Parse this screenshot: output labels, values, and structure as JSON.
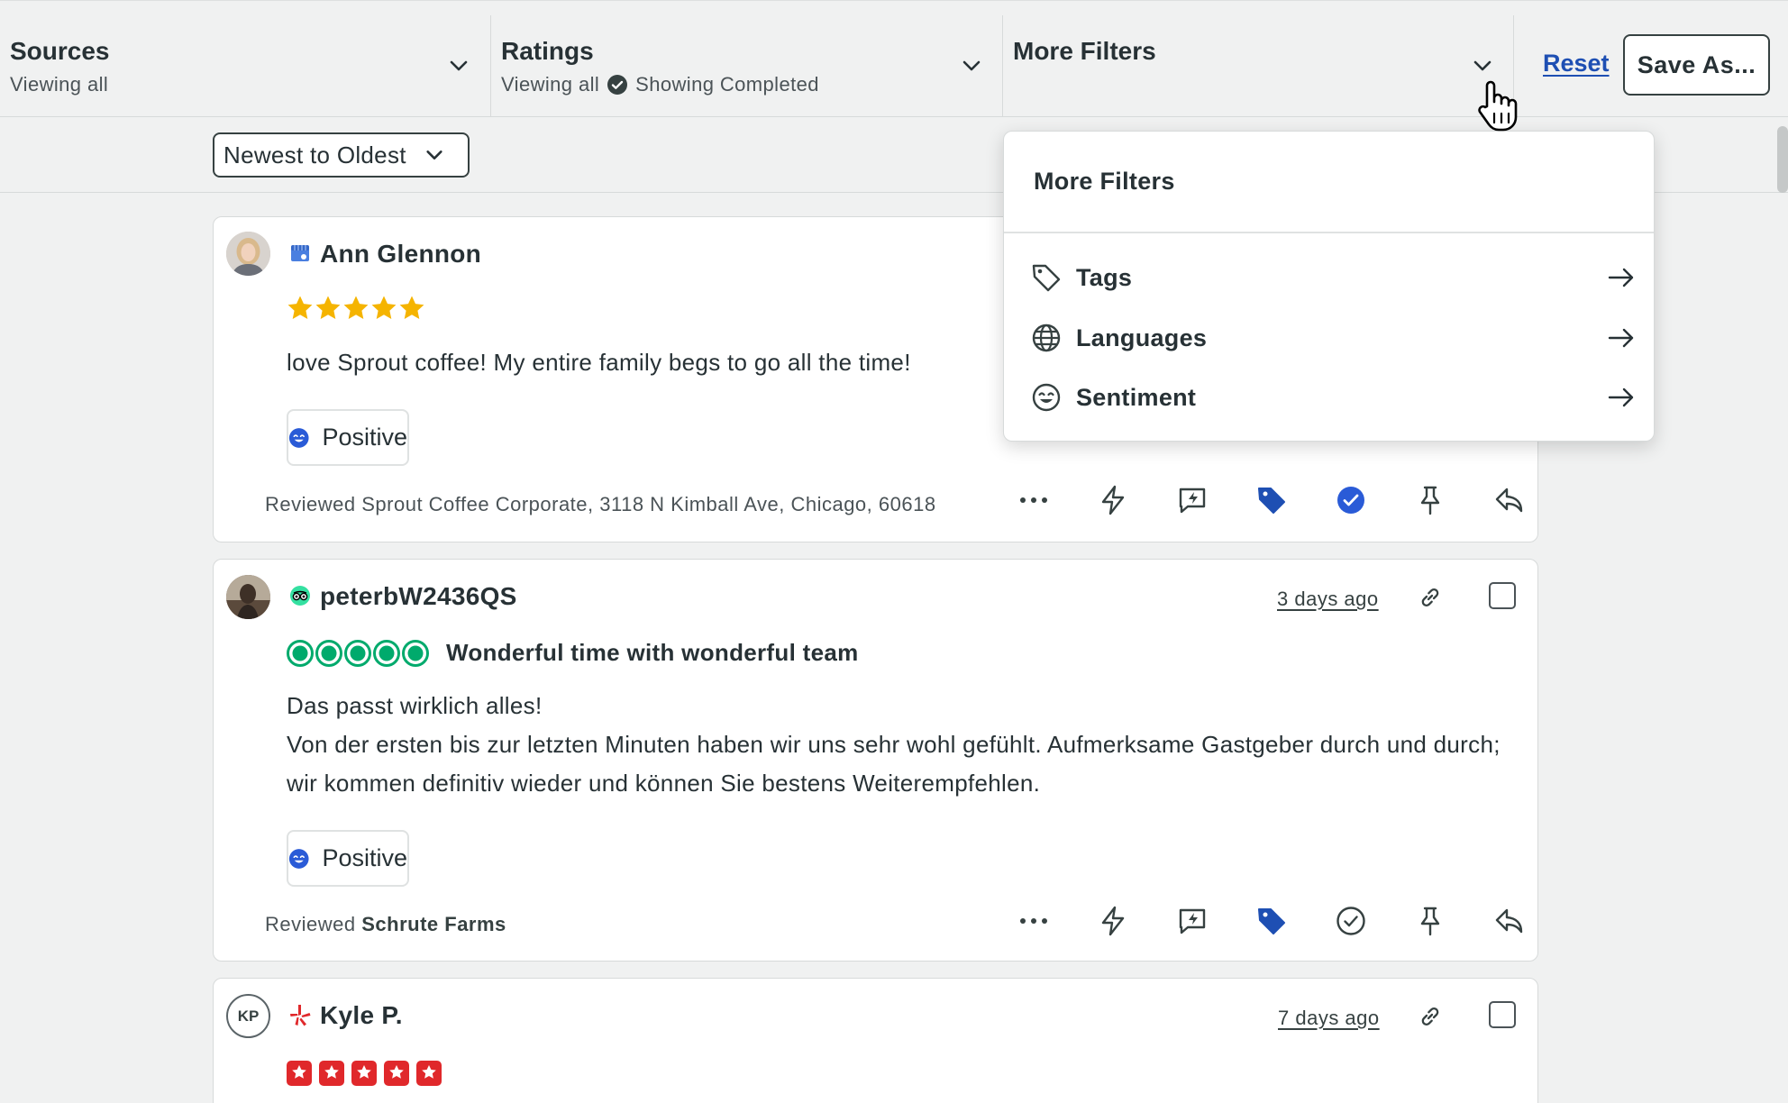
{
  "filters": {
    "sources": {
      "title": "Sources",
      "subtitle": "Viewing all"
    },
    "ratings": {
      "title": "Ratings",
      "subtitle": "Viewing all",
      "status": "Showing Completed"
    },
    "more": {
      "title": "More Filters"
    },
    "reset_label": "Reset",
    "save_label": "Save As..."
  },
  "sort": {
    "selected": "Newest to Oldest"
  },
  "dropdown": {
    "title": "More Filters",
    "items": [
      {
        "label": "Tags",
        "icon": "tag-icon"
      },
      {
        "label": "Languages",
        "icon": "globe-icon"
      },
      {
        "label": "Sentiment",
        "icon": "smile-icon"
      }
    ]
  },
  "reviews": [
    {
      "author": "Ann Glennon",
      "source": "Google",
      "rating": 5,
      "text": "love Sprout coffee! My entire family begs to go all the time!",
      "sentiment": "Positive",
      "reviewed_prefix": "Reviewed",
      "location": "Sprout Coffee Corporate, 3118 N Kimball Ave, Chicago, 60618",
      "completed": true
    },
    {
      "author": "peterbW2436QS",
      "source": "Tripadvisor",
      "rating": 5,
      "title": "Wonderful time with wonderful team",
      "text_line1": "Das passt wirklich alles!",
      "text_line2": "Von der ersten bis zur letzten Minuten haben wir uns sehr wohl gefühlt. Aufmerksame Gastgeber durch und durch; wir kommen definitiv wieder und können Sie bestens Weiterempfehlen.",
      "date": "3 days ago",
      "sentiment": "Positive",
      "reviewed_prefix": "Reviewed",
      "location": "Schrute Farms",
      "completed": false
    },
    {
      "author": "Kyle P.",
      "initials": "KP",
      "source": "Yelp",
      "rating": 5,
      "date": "7 days ago"
    }
  ],
  "colors": {
    "accent": "#1e4fb3",
    "google_star": "#f5b400",
    "tripadvisor": "#00aa6c",
    "yelp": "#e0282b",
    "positive": "#2a5bd7"
  }
}
